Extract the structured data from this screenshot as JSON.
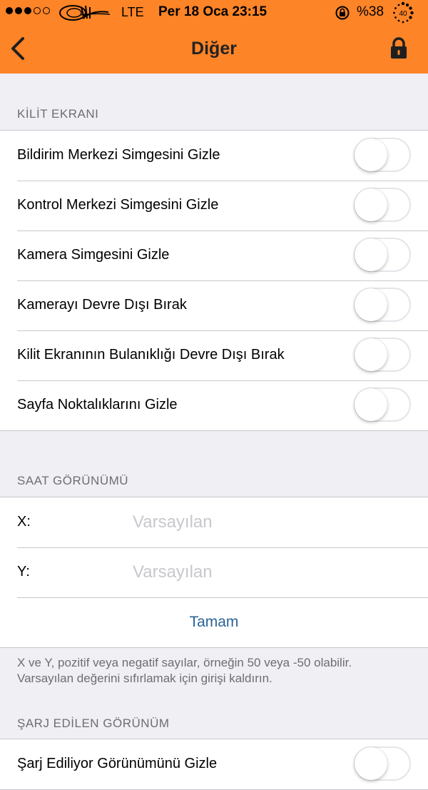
{
  "status_bar": {
    "signal_dots_filled": 3,
    "signal_dots_total": 5,
    "carrier_logo": "tughra-logo",
    "network": "LTE",
    "time": "Per 18 Oca 23:15",
    "rotation_lock_icon": "rotation-lock-icon",
    "battery": "%38",
    "battery_icon_label": "40"
  },
  "nav": {
    "title": "Diğer",
    "back_icon": "chevron-left-icon",
    "lock_icon": "lock-icon"
  },
  "sections": {
    "lock_screen": {
      "header": "KİLİT EKRANI",
      "rows": [
        {
          "label": "Bildirim Merkezi Simgesini Gizle",
          "on": false
        },
        {
          "label": "Kontrol Merkezi Simgesini Gizle",
          "on": false
        },
        {
          "label": "Kamera Simgesini  Gizle",
          "on": false
        },
        {
          "label": "Kamerayı Devre Dışı Bırak",
          "on": false
        },
        {
          "label": "Kilit Ekranının Bulanıklığı Devre Dışı Bırak",
          "on": false
        },
        {
          "label": "Sayfa Noktalıklarını Gizle",
          "on": false
        }
      ]
    },
    "clock_view": {
      "header": "SAAT GÖRÜNÜMÜ",
      "x_label": "X:",
      "x_placeholder": "Varsayılan",
      "y_label": "Y:",
      "y_placeholder": "Varsayılan",
      "done_button": "Tamam",
      "note": "X ve Y, pozitif veya negatif sayılar, örneğin 50 veya -50 olabilir. Varsayılan değerini sıfırlamak için girişi kaldırın."
    },
    "charging_view": {
      "header": "ŞARJ EDİLEN GÖRÜNÜM",
      "rows": [
        {
          "label": "Şarj Ediliyor Görünümünü Gizle",
          "on": false
        }
      ]
    }
  },
  "colors": {
    "accent": "#fd8427",
    "background": "#efeff4",
    "link": "#2a6496"
  }
}
